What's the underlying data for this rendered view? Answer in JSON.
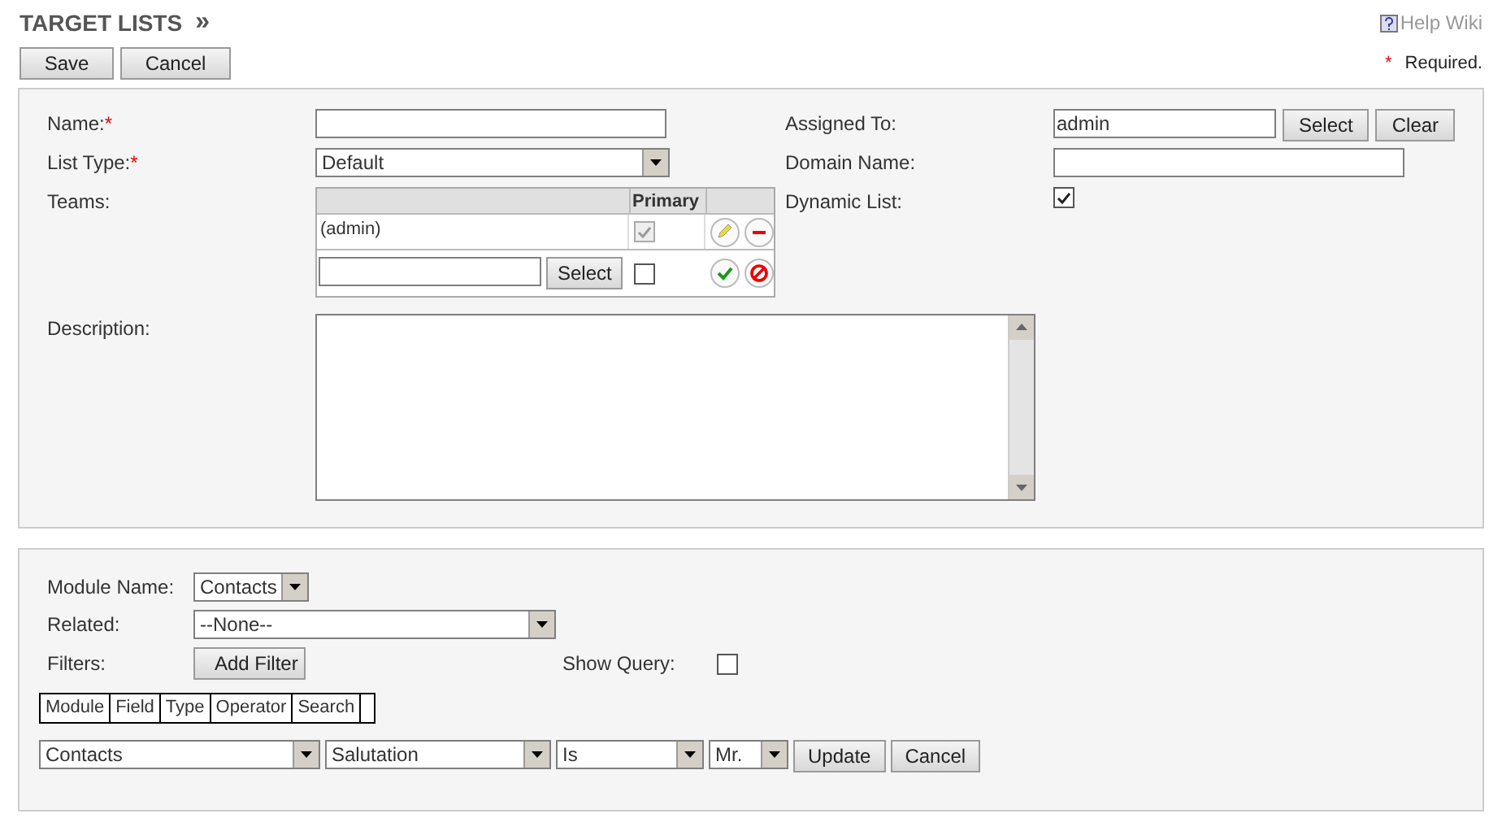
{
  "header": {
    "title": "TARGET LISTS",
    "arrow": "»",
    "help": "Help Wiki"
  },
  "actions": [
    "Save",
    "Cancel"
  ],
  "required_note": {
    "mark": "*",
    "text": "Required."
  },
  "left_fields": [
    {
      "kind": "text",
      "label": "Name:",
      "required_mark": "*"
    },
    {
      "kind": "select",
      "label": "List Type:",
      "required_mark": "*",
      "value": "Default"
    },
    {
      "kind": "teams",
      "label": "Teams:",
      "column": "Primary",
      "rows": [
        {
          "name": "(admin)",
          "primary": true
        }
      ],
      "new_row": {
        "button": "Select",
        "primary": false
      }
    }
  ],
  "right_fields": [
    {
      "kind": "user",
      "label": "Assigned To:",
      "value": "admin",
      "buttons": [
        "Select",
        "Clear"
      ]
    },
    {
      "kind": "text",
      "label": "Domain Name:"
    },
    {
      "kind": "checkbox",
      "label": "Dynamic List:",
      "checked": true
    }
  ],
  "description": {
    "label": "Description:"
  },
  "query": {
    "module_name": {
      "label": "Module Name:",
      "value": "Contacts"
    },
    "related": {
      "label": "Related:",
      "value": "--None--"
    },
    "filters": {
      "label": "Filters:",
      "button": "Add Filter"
    },
    "show_query": {
      "label": "Show Query:",
      "checked": false
    },
    "columns": [
      "Module",
      "Field",
      "Type",
      "Operator",
      "Search"
    ],
    "filter_row": {
      "selects": [
        "Contacts",
        "Salutation",
        "Is",
        "Mr."
      ],
      "buttons": [
        "Update",
        "Cancel"
      ]
    }
  }
}
